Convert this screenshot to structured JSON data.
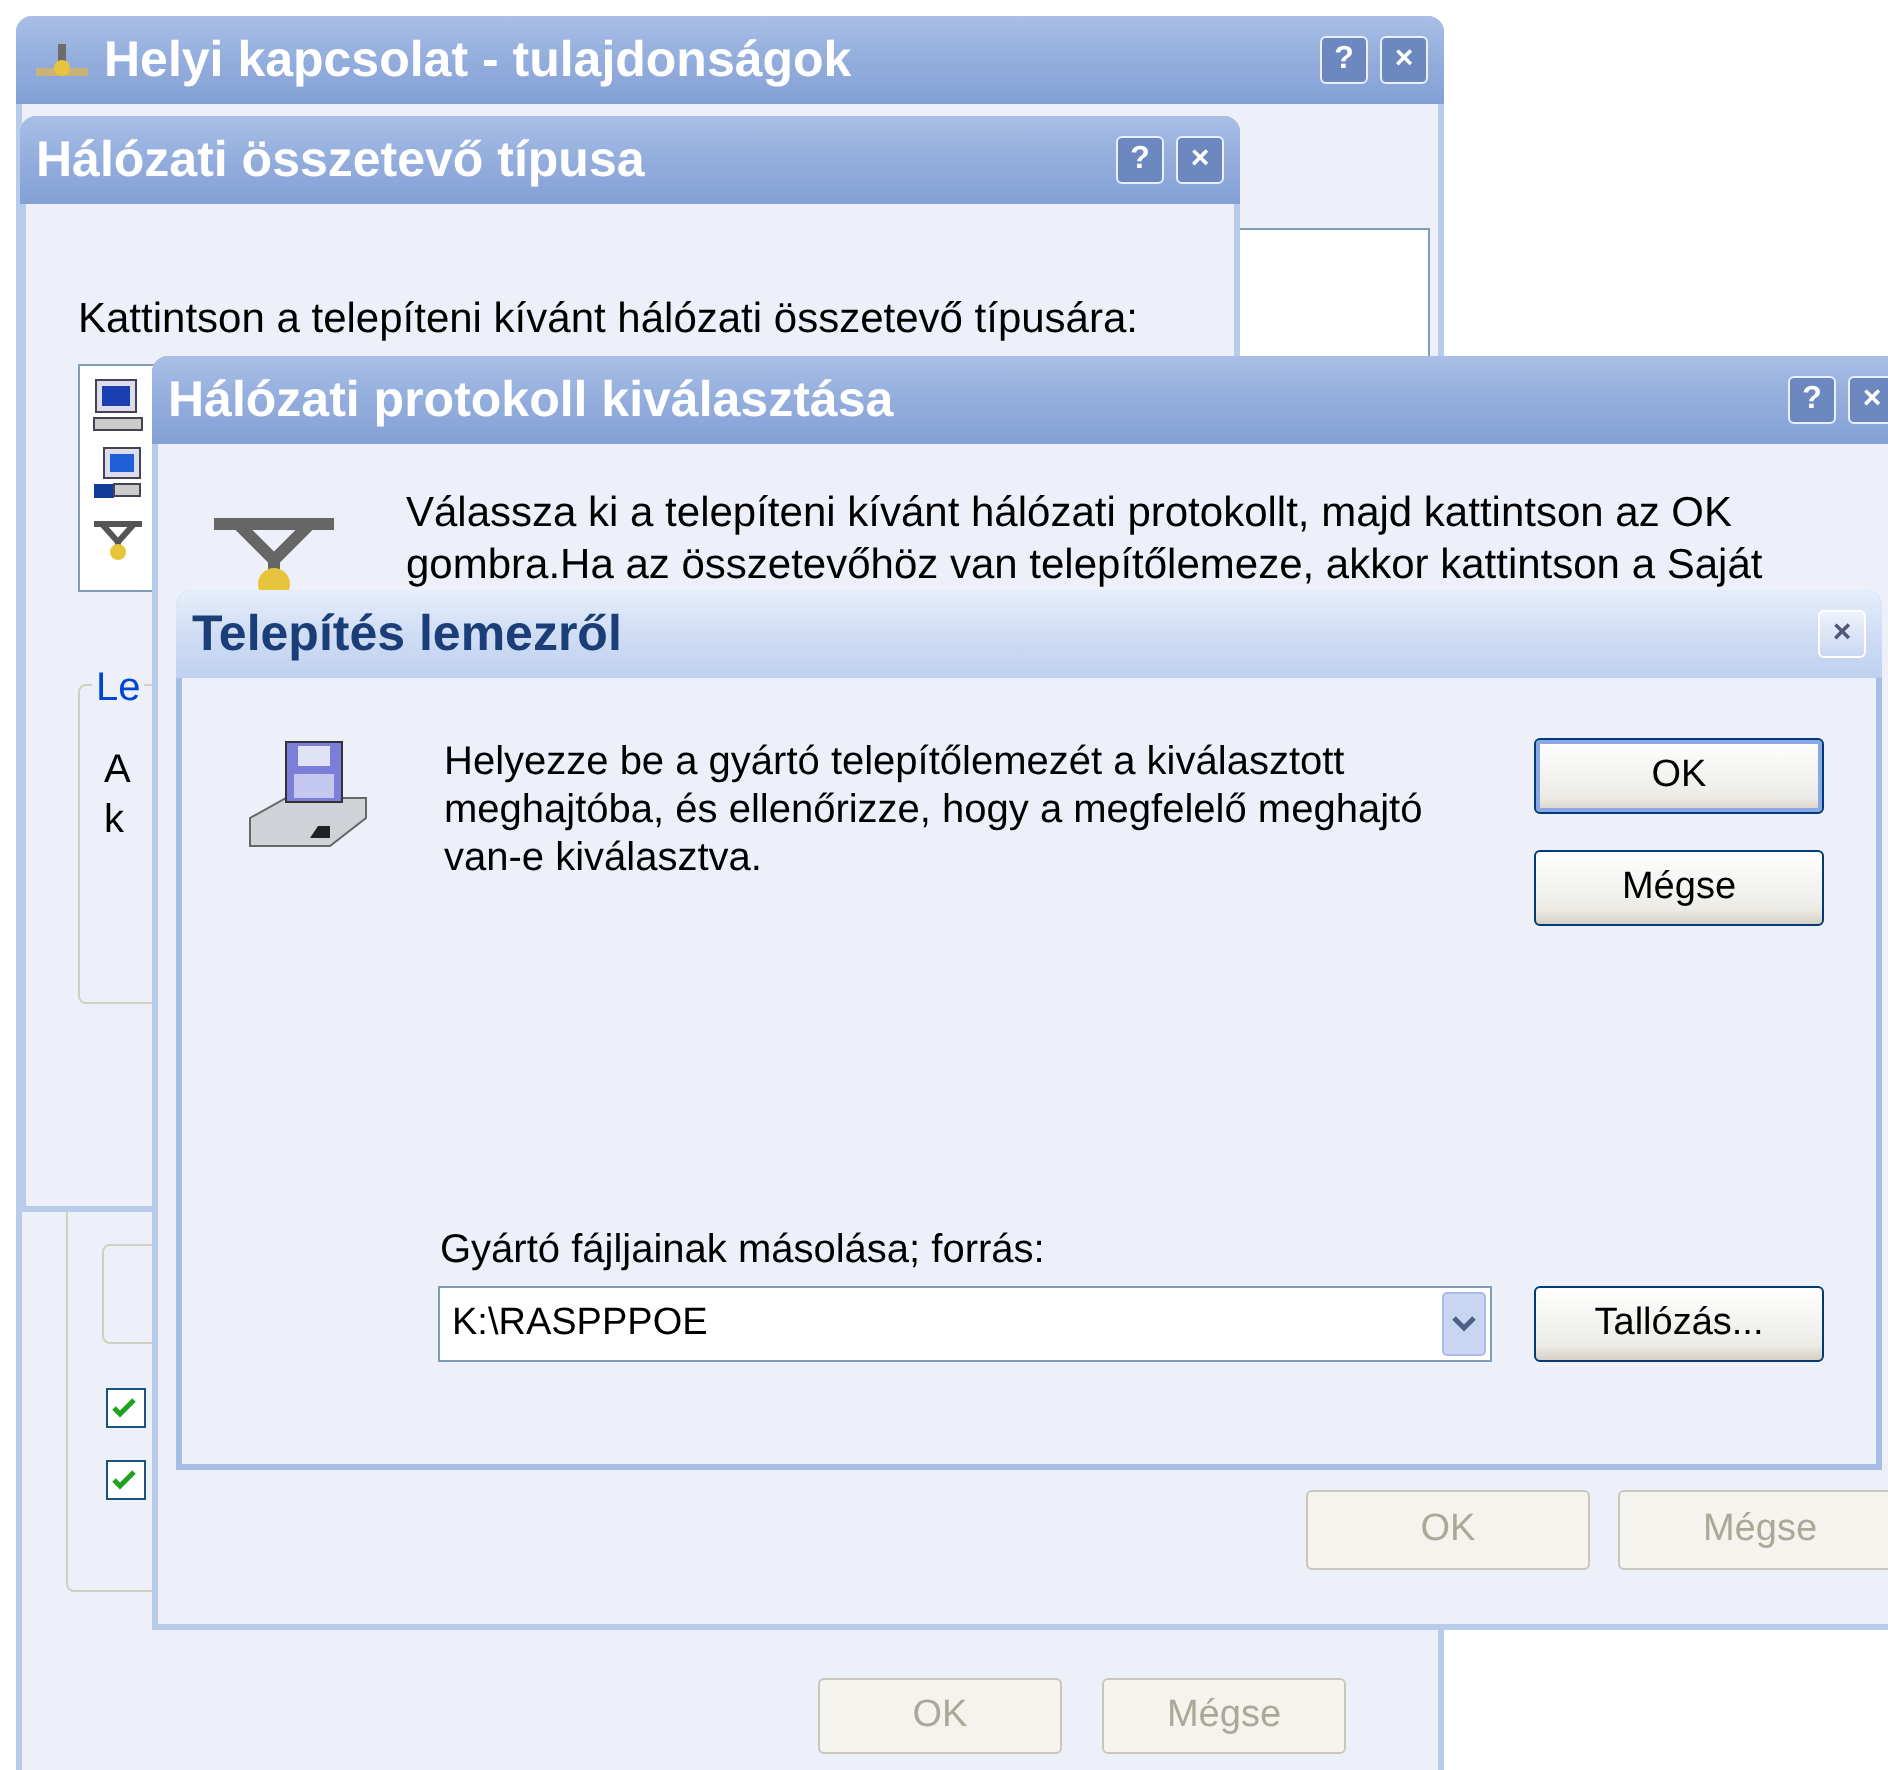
{
  "properties_window": {
    "title": "Helyi kapcsolat - tulajdonságok",
    "active": false,
    "help_button": "?",
    "close_button": "×",
    "checkboxes": [
      {
        "checked": true
      },
      {
        "checked": true
      }
    ],
    "buttons": [
      {
        "label": "OK",
        "disabled": true
      },
      {
        "label": "Mégse",
        "disabled": true
      }
    ]
  },
  "component_type_window": {
    "title": "Hálózati összetevő típusa",
    "active": false,
    "help_button": "?",
    "close_button": "×",
    "prompt": "Kattintson a telepíteni kívánt hálózati összetevő típusára:",
    "group": {
      "legend": "Le",
      "lines": [
        "A",
        "k"
      ]
    }
  },
  "protocol_window": {
    "title": "Hálózati protokoll kiválasztása",
    "active": false,
    "help_button": "?",
    "close_button": "×",
    "message": "Válassza ki a telepíteni kívánt hálózati protokollt, majd kattintson az OK gombra.Ha az összetevőhöz van telepítőlemeze, akkor kattintson a Saját",
    "buttons": [
      {
        "label": "OK",
        "disabled": true
      },
      {
        "label": "Mégse",
        "disabled": true
      }
    ]
  },
  "install_disk_dialog": {
    "title": "Telepítés lemezről",
    "active": true,
    "close_button": "×",
    "message": "Helyezze be a gyártó telepítőlemezét a kiválasztott meghajtóba, és ellenőrizze, hogy a megfelelő meghajtó van-e kiválasztva.",
    "buttons": [
      {
        "label": "OK",
        "disabled": false,
        "default": true
      },
      {
        "label": "Mégse",
        "disabled": false,
        "default": false
      }
    ],
    "source_label": "Gyártó fájljainak másolása; forrás:",
    "source_value": "K:\\RASPPPOE",
    "browse_button": {
      "label": "Tallózás...",
      "disabled": false
    }
  }
}
